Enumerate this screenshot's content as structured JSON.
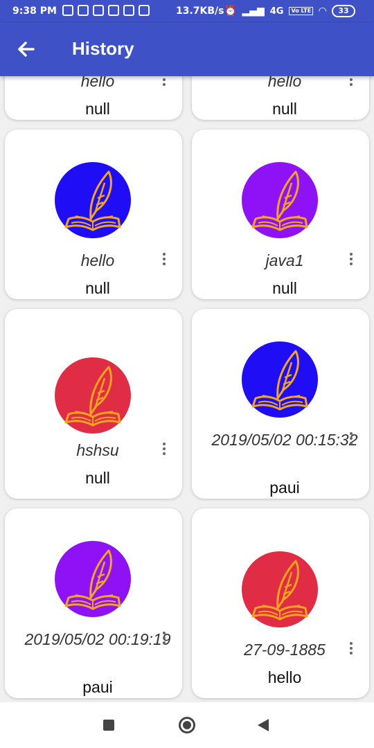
{
  "status_bar": {
    "time": "9:38 PM",
    "speed": "13.7KB/s",
    "network": "4G",
    "volte": "Vo LTE",
    "battery": "33"
  },
  "app_bar": {
    "title": "History",
    "back_icon": "arrow-left-icon"
  },
  "cards": [
    {
      "title": "hello",
      "subtitle": "null",
      "avatar_color": "",
      "partial": true
    },
    {
      "title": "hello",
      "subtitle": "null",
      "avatar_color": "",
      "partial": true
    },
    {
      "title": "hello",
      "subtitle": "null",
      "avatar_color": "#1f0df5"
    },
    {
      "title": "java1",
      "subtitle": "null",
      "avatar_color": "#8e12f5"
    },
    {
      "title": "hshsu",
      "subtitle": "null",
      "avatar_color": "#e02d45"
    },
    {
      "title": "2019/05/02 00:15:32",
      "subtitle": "paui",
      "avatar_color": "#1f0df5"
    },
    {
      "title": "2019/05/02 00:19:19",
      "subtitle": "paui",
      "avatar_color": "#8e12f5"
    },
    {
      "title": "27-09-1885",
      "subtitle": "hello",
      "avatar_color": "#e02d45"
    }
  ],
  "avatar_icon": "quill-book-icon",
  "icon_color": "#f4a51c",
  "nav_bar": {
    "recents_icon": "square-icon",
    "home_icon": "circle-icon",
    "back_icon": "triangle-back-icon"
  }
}
